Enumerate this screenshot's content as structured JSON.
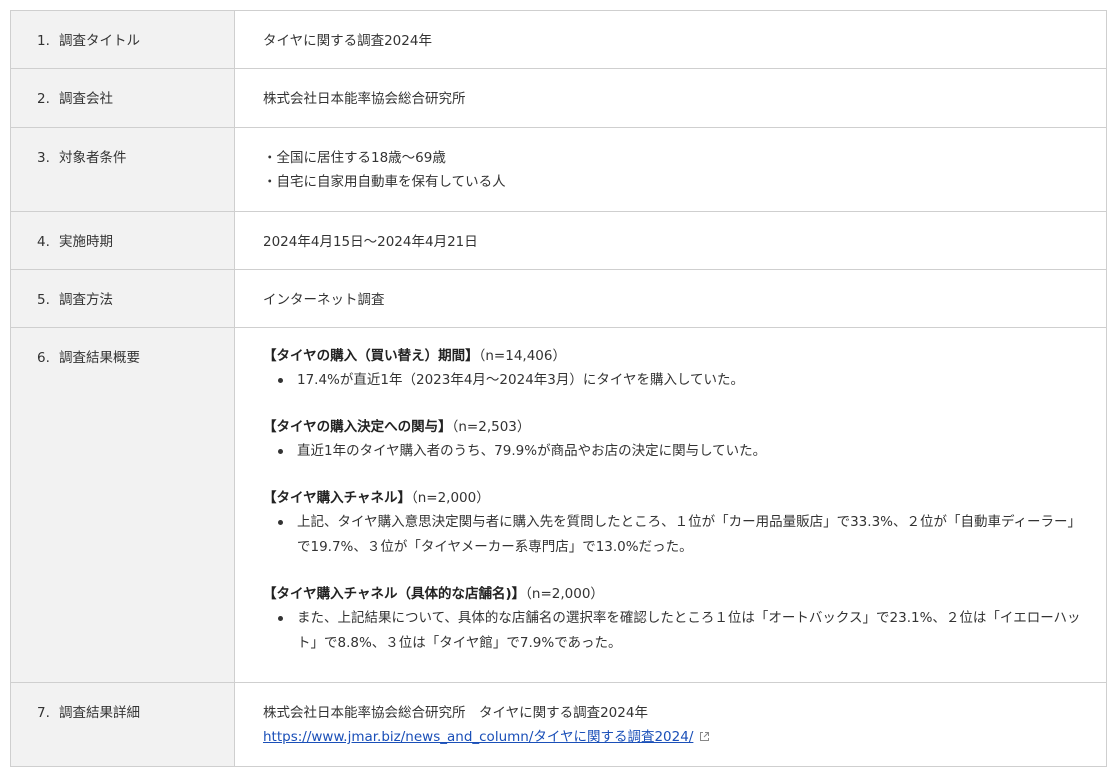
{
  "rows": [
    {
      "num": "1.",
      "label": "調査タイトル"
    },
    {
      "num": "2.",
      "label": "調査会社"
    },
    {
      "num": "3.",
      "label": "対象者条件"
    },
    {
      "num": "4.",
      "label": "実施時期"
    },
    {
      "num": "5.",
      "label": "調査方法"
    },
    {
      "num": "6.",
      "label": "調査結果概要"
    },
    {
      "num": "7.",
      "label": "調査結果詳細"
    }
  ],
  "title_value": "タイヤに関する調査2024年",
  "company_value": "株式会社日本能率協会総合研究所",
  "conditions": [
    "・全国に居住する18歳～69歳",
    "・自宅に自家用自動車を保有している人"
  ],
  "period_value": "2024年4月15日～2024年4月21日",
  "method_value": "インターネット調査",
  "summary": [
    {
      "heading": "【タイヤの購入（買い替え）期間】",
      "n": "（n=14,406）",
      "bullet": "17.4%が直近1年（2023年4月～2024年3月）にタイヤを購入していた。"
    },
    {
      "heading": "【タイヤの購入決定への関与】",
      "n": "（n=2,503）",
      "bullet": "直近1年のタイヤ購入者のうち、79.9%が商品やお店の決定に関与していた。"
    },
    {
      "heading": "【タイヤ購入チャネル】",
      "n": "（n=2,000）",
      "bullet": "上記、タイヤ購入意思決定関与者に購入先を質問したところ、１位が「カー用品量販店」で33.3%、２位が「自動車ディーラー」で19.7%、３位が「タイヤメーカー系専門店」で13.0%だった。"
    },
    {
      "heading": "【タイヤ購入チャネル（具体的な店舗名)】",
      "n": "（n=2,000）",
      "bullet": "また、上記結果について、具体的な店舗名の選択率を確認したところ１位は「オートバックス」で23.1%、２位は「イエローハット」で8.8%、３位は「タイヤ館」で7.9%であった。"
    }
  ],
  "detail": {
    "text": "株式会社日本能率協会総合研究所　タイヤに関する調査2024年",
    "link_text": "https://www.jmar.biz/news_and_column/タイヤに関する調査2024/"
  },
  "icons": {
    "external_link": "external-link-icon"
  },
  "colors": {
    "label_bg": "#f2f2f2",
    "border": "#cfcfcf",
    "link": "#1a4fb8"
  }
}
